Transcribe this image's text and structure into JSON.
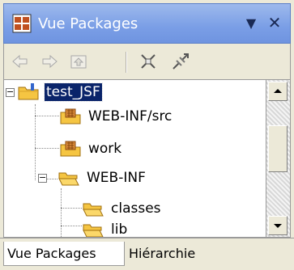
{
  "window": {
    "title": "Vue Packages",
    "menu_icon": "chevron-down-icon",
    "close_icon": "close-icon"
  },
  "toolbar": {
    "items": [
      {
        "name": "back-icon",
        "enabled": false
      },
      {
        "name": "forward-icon",
        "enabled": false
      },
      {
        "name": "up-icon",
        "enabled": false
      },
      {
        "name": "collapse-all-icon",
        "enabled": true
      },
      {
        "name": "link-with-editor-icon",
        "enabled": true
      }
    ]
  },
  "tree": {
    "items": [
      {
        "label": "test_JSF",
        "icon": "project-folder-icon",
        "expanded": true,
        "selected": true
      },
      {
        "label": "WEB-INF/src",
        "icon": "source-folder-icon"
      },
      {
        "label": "work",
        "icon": "source-folder-icon"
      },
      {
        "label": "WEB-INF",
        "icon": "folder-icon",
        "expanded": true
      },
      {
        "label": "classes",
        "icon": "folder-icon"
      },
      {
        "label": "lib",
        "icon": "folder-icon"
      }
    ]
  },
  "tabs": {
    "active": "Vue Packages",
    "other": "Hiérarchie"
  },
  "colors": {
    "title_bar": "#7a9ee6",
    "selection": "#0a246a",
    "folder": "#f5c542",
    "source_folder_badge": "#a05a1c"
  }
}
